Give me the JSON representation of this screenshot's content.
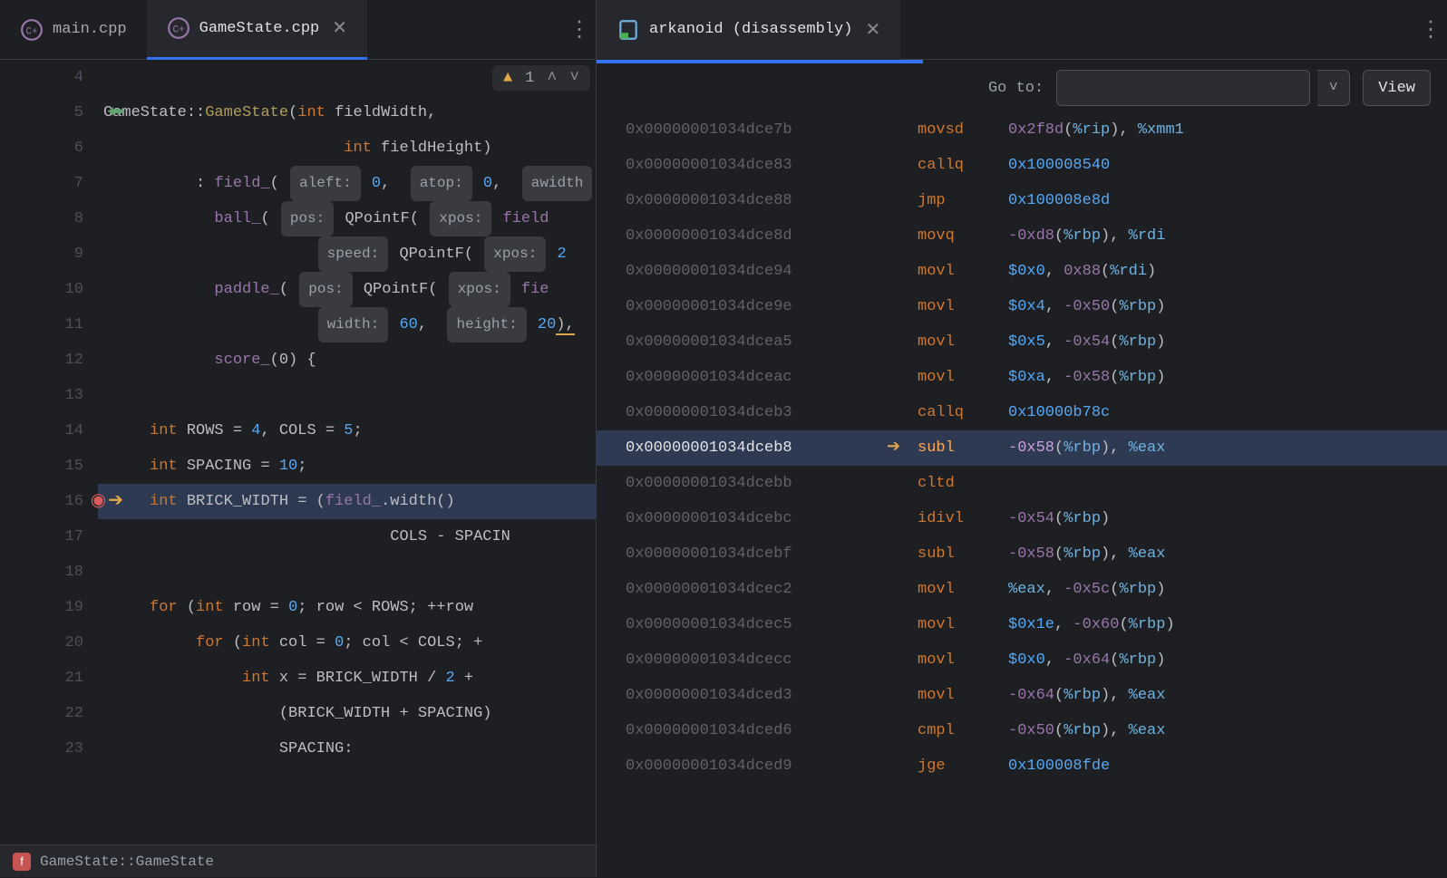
{
  "left": {
    "tabs": {
      "main": "main.cpp",
      "active": "GameState.cpp"
    },
    "inspection": {
      "count": "1"
    },
    "gutter": {
      "start": 4,
      "end": 23,
      "exec_line": 16,
      "green_arrow_line": 5
    },
    "code": {
      "l5_a": "GameState",
      "l5_b": "::",
      "l5_c": "GameState",
      "l5_d": "(",
      "l5_e": "int",
      "l5_f": " fieldWidth,",
      "l6_a": "int",
      "l6_b": " fieldHeight)",
      "l7_a": ": ",
      "l7_b": "field_",
      "l7_c": "(",
      "h_aleft": "aleft:",
      "l7_d": " 0",
      "l7_e": ",",
      "h_atop": "atop:",
      "l7_f": " 0",
      "l7_g": ",",
      "h_awidth": "awidth",
      "l8_a": "ball_",
      "l8_b": "(",
      "h_pos": "pos:",
      "l8_c": " QPointF(",
      "h_xpos": "xpos:",
      "l8_d": " field",
      "l9_a": "",
      "h_speed": "speed:",
      "l9_b": " QPointF(",
      "l9_c": " 2",
      "l10_a": "paddle_",
      "l10_b": "(",
      "l10_c": " QPointF(",
      "l10_d": " fie",
      "l11_a": "",
      "h_width": "width:",
      "l11_b": " 60",
      "l11_c": ",",
      "h_height": "height:",
      "l11_d": " 20",
      "l11_e": "),",
      "l12_a": "score_",
      "l12_b": "(0) {",
      "l14_a": "int",
      "l14_b": " ROWS = ",
      "l14_c": "4",
      "l14_d": ", COLS = ",
      "l14_e": "5",
      "l14_f": ";",
      "l15_a": "int",
      "l15_b": " SPACING = ",
      "l15_c": "10",
      "l15_d": ";",
      "l16_a": "int",
      "l16_b": " BRICK_WIDTH = (",
      "l16_c": "field_",
      "l16_d": ".width()",
      "l17_a": "COLS - SPACIN",
      "l19_a": "for",
      "l19_b": " (",
      "l19_c": "int",
      "l19_d": " row = ",
      "l19_e": "0",
      "l19_f": "; row < ROWS; ++row",
      "l20_a": "for",
      "l20_b": " (",
      "l20_c": "int",
      "l20_d": " col = ",
      "l20_e": "0",
      "l20_f": "; col < COLS; +",
      "l21_a": "int",
      "l21_b": " x = BRICK_WIDTH / ",
      "l21_c": "2",
      "l21_d": " +",
      "l22_a": "(BRICK_WIDTH + SPACING)",
      "l23_a": "SPACING:"
    },
    "breadcrumb": {
      "icon_letter": "f",
      "text": "GameState::GameState"
    }
  },
  "right": {
    "tab": "arkanoid (disassembly)",
    "goto_label": "Go to:",
    "view_btn": "View",
    "rows": [
      {
        "addr": "0x00000001034dce7b",
        "mnem": "movsd",
        "ops": "0x2f8d(%rip), %xmm1"
      },
      {
        "addr": "0x00000001034dce83",
        "mnem": "callq",
        "ops": "0x100008540"
      },
      {
        "addr": "0x00000001034dce88",
        "mnem": "jmp",
        "ops": "0x100008e8d"
      },
      {
        "addr": "0x00000001034dce8d",
        "mnem": "movq",
        "ops": "-0xd8(%rbp), %rdi"
      },
      {
        "addr": "0x00000001034dce94",
        "mnem": "movl",
        "ops": "$0x0, 0x88(%rdi)"
      },
      {
        "addr": "0x00000001034dce9e",
        "mnem": "movl",
        "ops": "$0x4, -0x50(%rbp)"
      },
      {
        "addr": "0x00000001034dcea5",
        "mnem": "movl",
        "ops": "$0x5, -0x54(%rbp)"
      },
      {
        "addr": "0x00000001034dceac",
        "mnem": "movl",
        "ops": "$0xa, -0x58(%rbp)"
      },
      {
        "addr": "0x00000001034dceb3",
        "mnem": "callq",
        "ops": "0x10000b78c"
      },
      {
        "addr": "0x00000001034dceb8",
        "mnem": "subl",
        "ops": "-0x58(%rbp), %eax",
        "exec": true
      },
      {
        "addr": "0x00000001034dcebb",
        "mnem": "cltd",
        "ops": ""
      },
      {
        "addr": "0x00000001034dcebc",
        "mnem": "idivl",
        "ops": "-0x54(%rbp)"
      },
      {
        "addr": "0x00000001034dcebf",
        "mnem": "subl",
        "ops": "-0x58(%rbp), %eax"
      },
      {
        "addr": "0x00000001034dcec2",
        "mnem": "movl",
        "ops": "%eax, -0x5c(%rbp)"
      },
      {
        "addr": "0x00000001034dcec5",
        "mnem": "movl",
        "ops": "$0x1e, -0x60(%rbp)"
      },
      {
        "addr": "0x00000001034dcecc",
        "mnem": "movl",
        "ops": "$0x0, -0x64(%rbp)"
      },
      {
        "addr": "0x00000001034dced3",
        "mnem": "movl",
        "ops": "-0x64(%rbp), %eax"
      },
      {
        "addr": "0x00000001034dced6",
        "mnem": "cmpl",
        "ops": "-0x50(%rbp), %eax"
      },
      {
        "addr": "0x00000001034dced9",
        "mnem": "jge",
        "ops": "0x100008fde"
      }
    ]
  }
}
